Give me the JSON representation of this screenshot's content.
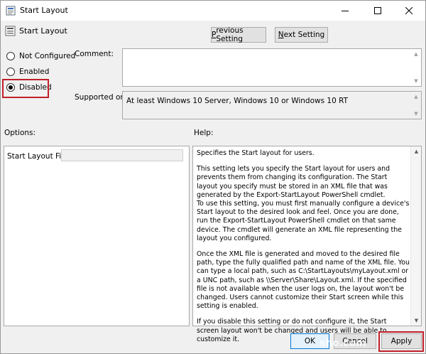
{
  "window": {
    "title": "Start Layout",
    "header_title": "Start Layout"
  },
  "nav": {
    "previous_prefix": "",
    "previous_underlined": "P",
    "previous_rest": "revious Setting",
    "next_underlined": "N",
    "next_rest": "ext Setting"
  },
  "state": {
    "options": [
      {
        "prefix": "",
        "underlined": "C",
        "label_pre": "Not ",
        "label_post": "onfigured",
        "selected": false
      },
      {
        "underlined": "E",
        "label_post": "nabled",
        "selected": false
      },
      {
        "underlined": "D",
        "label_post": "isabled",
        "selected": true
      }
    ],
    "not_configured": "Not Configured",
    "enabled": "Enabled",
    "disabled": "Disabled"
  },
  "labels": {
    "comment": "Comment:",
    "supported_on": "Supported on:",
    "options": "Options:",
    "help": "Help:"
  },
  "comment_value": "",
  "supported_on_value": "At least Windows 10 Server, Windows 10 or Windows 10 RT",
  "options_pane": {
    "field_label": "Start Layout File",
    "field_value": ""
  },
  "help": {
    "p1": "Specifies the Start layout for users.",
    "p2": "This setting lets you specify the Start layout for users and prevents them from changing its configuration. The Start layout you specify must be stored in an XML file that was generated by the Export-StartLayout PowerShell cmdlet.",
    "p3": "To use this setting, you must first manually configure a device's Start layout to the desired look and feel. Once you are done, run the Export-StartLayout PowerShell cmdlet on that same device. The cmdlet will generate an XML file representing the layout you configured.",
    "p4": "Once the XML file is generated and moved to the desired file path, type the fully qualified path and name of the XML file. You can type a local path, such as C:\\StartLayouts\\myLayout.xml or a UNC path, such as \\\\Server\\Share\\Layout.xml. If the specified file is not available when the user logs on, the layout won't be changed. Users cannot customize their Start screen while this setting is enabled.",
    "p5": "If you disable this setting or do not configure it, the Start screen layout won't be changed and users will be able to customize it."
  },
  "buttons": {
    "ok": "OK",
    "cancel": "Cancel",
    "apply": "Apply"
  },
  "watermark": "sho.com",
  "icons": {
    "title": "policy-document-icon",
    "header": "policy-setting-icon"
  },
  "colors": {
    "highlight": "#c0202a",
    "focus": "#0078d7"
  }
}
